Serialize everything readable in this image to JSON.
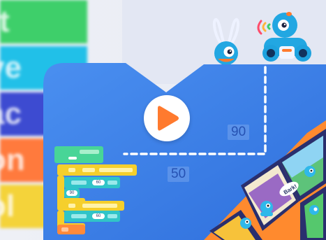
{
  "categories": [
    {
      "label": "rt",
      "color": "#3ecf6a"
    },
    {
      "label": "ve",
      "color": "#21c0e8"
    },
    {
      "label": "ac",
      "color": "#3d4bd1"
    },
    {
      "label": "on",
      "color": "#ff7a3d"
    },
    {
      "label": "ol",
      "color": "#f4d33a"
    }
  ],
  "measurements": {
    "vertical": "90",
    "horizontal": "50"
  },
  "code_values": [
    "60",
    "90",
    "60"
  ],
  "showcase_text": "Bark!",
  "colors": {
    "board_blue": "#3b7fe6",
    "board_blue_dark": "#2f6dd6",
    "play_orange": "#ff7a2e",
    "code_green": "#48d597",
    "code_yellow": "#f5cf2c",
    "code_teal": "#31c4c8",
    "code_orange": "#ff8a3a"
  },
  "icons": {
    "play": "play-triangle-icon",
    "robot_dot": "dot-robot-icon",
    "robot_dash": "dash-robot-icon"
  }
}
